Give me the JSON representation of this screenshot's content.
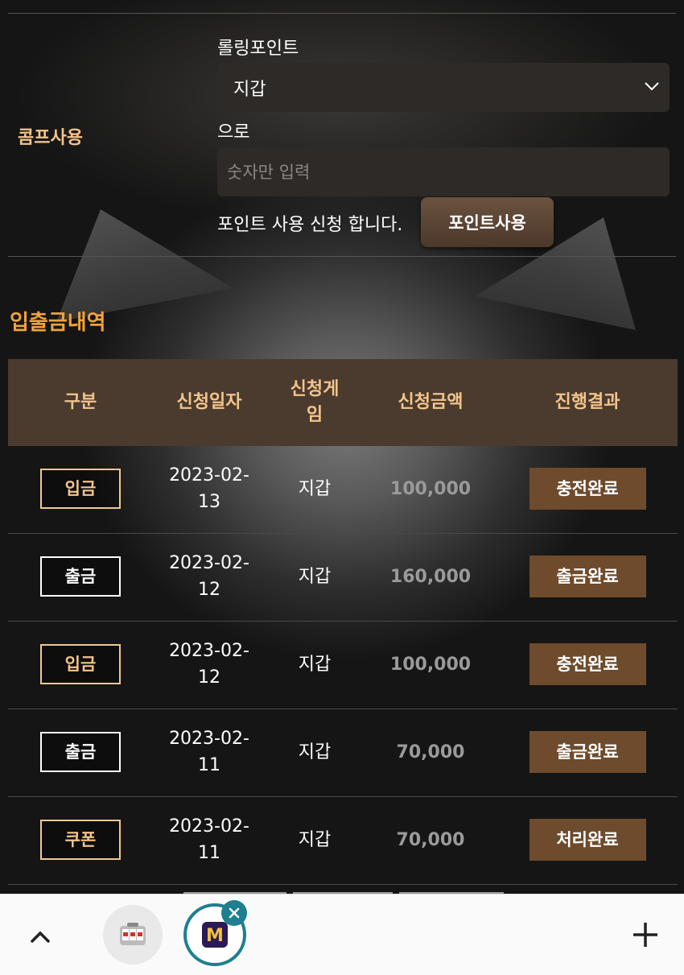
{
  "comp_section": {
    "label": "콤프사용",
    "rolling_label": "롤링포인트",
    "select_value": "지갑",
    "euro_label": "으로",
    "amount_placeholder": "숫자만 입력",
    "apply_text": "포인트 사용 신청 합니다.",
    "apply_button": "포인트사용"
  },
  "history": {
    "title": "입출금내역",
    "columns": [
      "구분",
      "신청일자",
      "신청게\n임",
      "신청금액",
      "진행결과"
    ],
    "rows": [
      {
        "type": "입금",
        "date": "2023-02-\n13",
        "game": "지갑",
        "amount": "100,000",
        "result": "충전완료"
      },
      {
        "type": "출금",
        "date": "2023-02-\n12",
        "game": "지갑",
        "amount": "160,000",
        "result": "출금완료"
      },
      {
        "type": "입금",
        "date": "2023-02-\n12",
        "game": "지갑",
        "amount": "100,000",
        "result": "충전완료"
      },
      {
        "type": "출금",
        "date": "2023-02-\n11",
        "game": "지갑",
        "amount": "70,000",
        "result": "출금완료"
      },
      {
        "type": "쿠폰",
        "date": "2023-02-\n11",
        "game": "지갑",
        "amount": "70,000",
        "result": "처리완료"
      }
    ]
  },
  "bottom_bar": {
    "icons": [
      "chevron-up-icon",
      "slot-machine-icon",
      "m-app-icon",
      "close-icon",
      "plus-icon"
    ]
  },
  "colors": {
    "accent_gold": "#f3c48a",
    "title_orange": "#f0a23c",
    "result_brown": "#6e4b2c",
    "header_brown": "#4a3b2e",
    "tab_teal": "#1d7f8f"
  }
}
